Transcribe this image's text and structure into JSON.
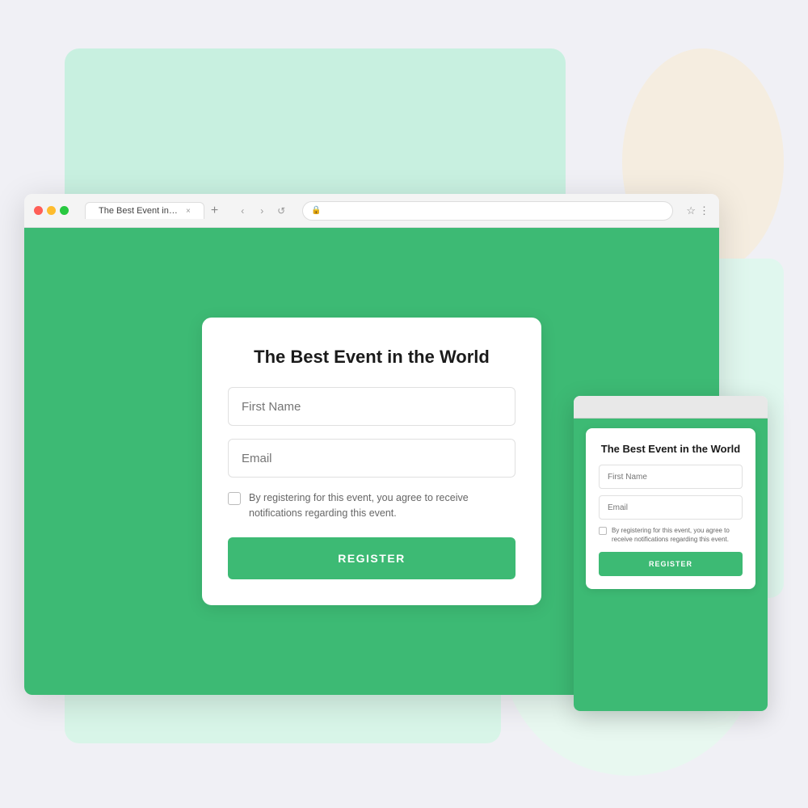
{
  "colors": {
    "green": "#3dba74",
    "bg_light": "#f0f0f5",
    "bg_green_light": "#c8f0e0",
    "bg_cream": "#f5ede0"
  },
  "desktop": {
    "browser": {
      "tab_label": "The Best Event in the World",
      "tab_close": "×",
      "tab_new": "+",
      "nav_back": "‹",
      "nav_forward": "›",
      "nav_refresh": "↺",
      "address_lock": "🔒",
      "bookmark_icon": "☆",
      "menu_icon": "⋮"
    },
    "form": {
      "title": "The Best Event in the World",
      "first_name_placeholder": "First Name",
      "email_placeholder": "Email",
      "checkbox_label": "By registering for this event, you agree to receive notifications regarding this event.",
      "register_button": "REGISTER"
    }
  },
  "mobile": {
    "form": {
      "title": "The Best Event in the World",
      "first_name_placeholder": "First Name",
      "email_placeholder": "Email",
      "checkbox_label": "By registering for this event, you agree to receive notifications regarding this event.",
      "register_button": "REGISTER"
    }
  }
}
